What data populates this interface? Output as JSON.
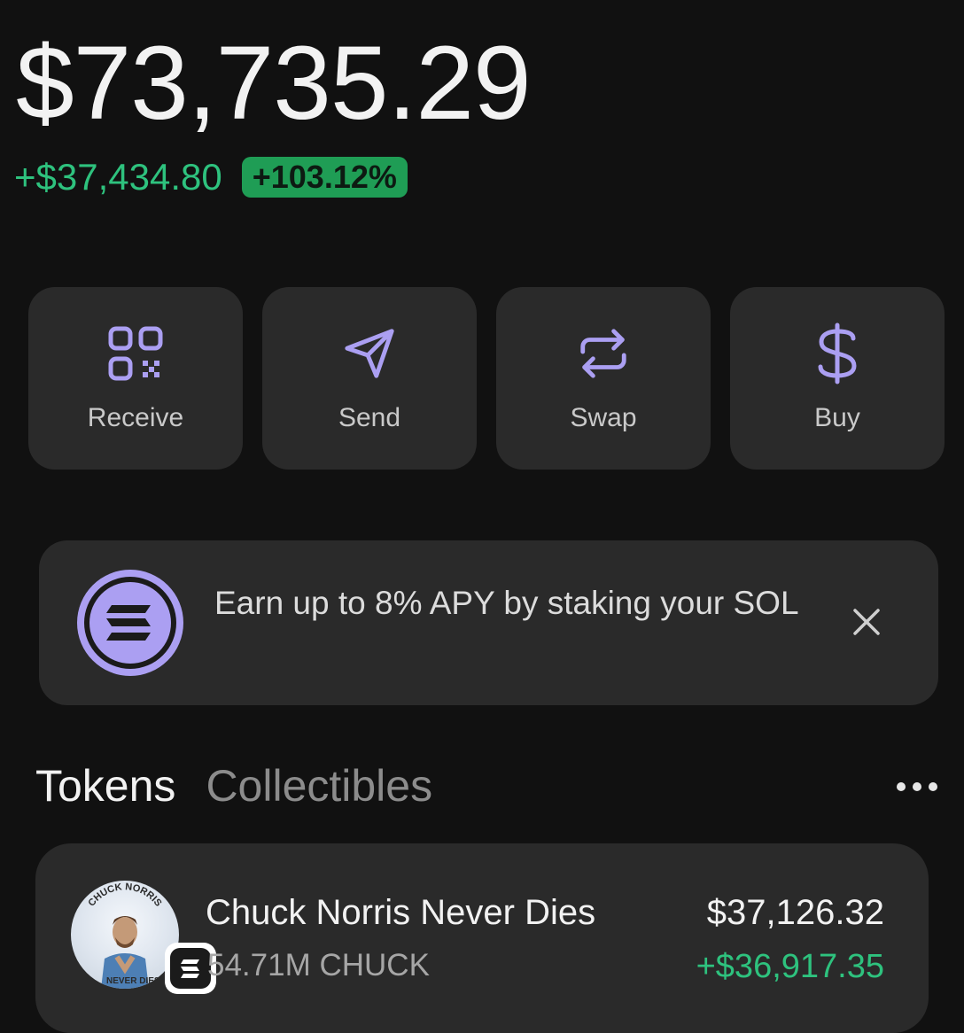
{
  "balance": {
    "total": "$73,735.29",
    "change_amount": "+$37,434.80",
    "change_percent": "+103.12%"
  },
  "colors": {
    "accent": "#ab9ff2",
    "positive": "#2ec27e",
    "card_bg": "#2a2a2a",
    "page_bg": "#111111"
  },
  "actions": [
    {
      "label": "Receive",
      "icon": "qr-code-icon"
    },
    {
      "label": "Send",
      "icon": "send-icon"
    },
    {
      "label": "Swap",
      "icon": "swap-icon"
    },
    {
      "label": "Buy",
      "icon": "dollar-icon"
    }
  ],
  "banner": {
    "text": "Earn up to 8% APY by staking your SOL",
    "icon": "solana-icon"
  },
  "tabs": [
    {
      "label": "Tokens",
      "active": true
    },
    {
      "label": "Collectibles",
      "active": false
    }
  ],
  "tokens": [
    {
      "name": "Chuck Norris Never Dies",
      "amount": "54.71M CHUCK",
      "value": "$37,126.32",
      "change": "+$36,917.35",
      "avatar_caption_top": "CHUCK NORRIS",
      "avatar_caption_bottom": "NEVER DIES"
    }
  ]
}
